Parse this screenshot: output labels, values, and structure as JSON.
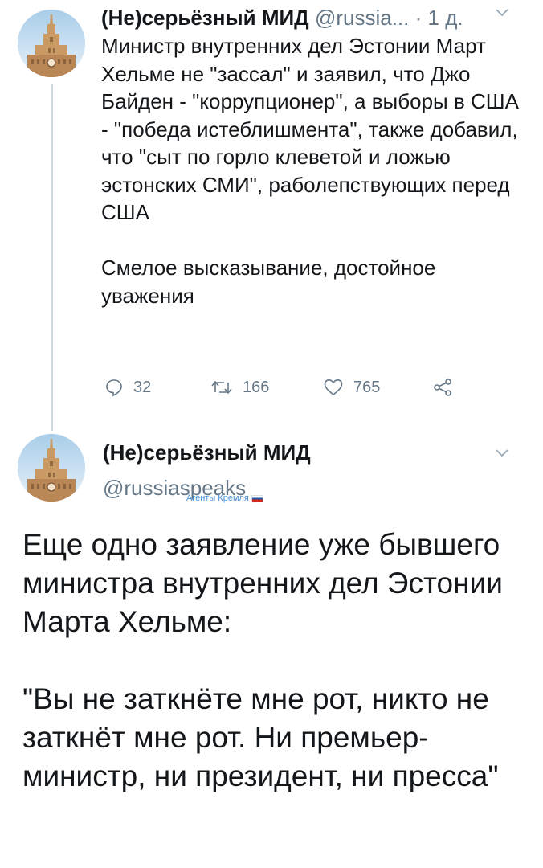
{
  "tweet1": {
    "author_name": "(Не)серьёзный МИД",
    "handle": "@russia...",
    "separator": "·",
    "time": "1 д.",
    "text": "Министр внутренних дел Эстонии Март Хельме не \"зассал\" и заявил, что Джо Байден - \"коррупционер\", а выборы в США - \"победа истеблишмента\", также добавил, что \"сыт по горло клеветой и ложью эстонских СМИ\", раболепствующих перед США\n\nСмелое высказывание, достойное уважения",
    "replies": "32",
    "retweets": "166",
    "likes": "765",
    "icons": [
      "reply-icon",
      "retweet-icon",
      "like-icon",
      "share-icon",
      "chevron-down-icon"
    ]
  },
  "tweet2": {
    "author_name": "(Не)серьёзный МИД",
    "handle": "@russiaspeaks",
    "text": "Еще одно заявление уже бывшего министра внутренних дел Эстонии Марта Хельме:\n\n\"Вы не заткнёте мне рот, никто не заткнёт мне рот. Ни премьер-министр, ни президент, ни пресса\""
  },
  "watermark": {
    "text": "Агенты Кремля"
  },
  "colors": {
    "text": "#14171a",
    "muted": "#657786",
    "thread_line": "#cfd9de",
    "link": "#4a90d9"
  }
}
